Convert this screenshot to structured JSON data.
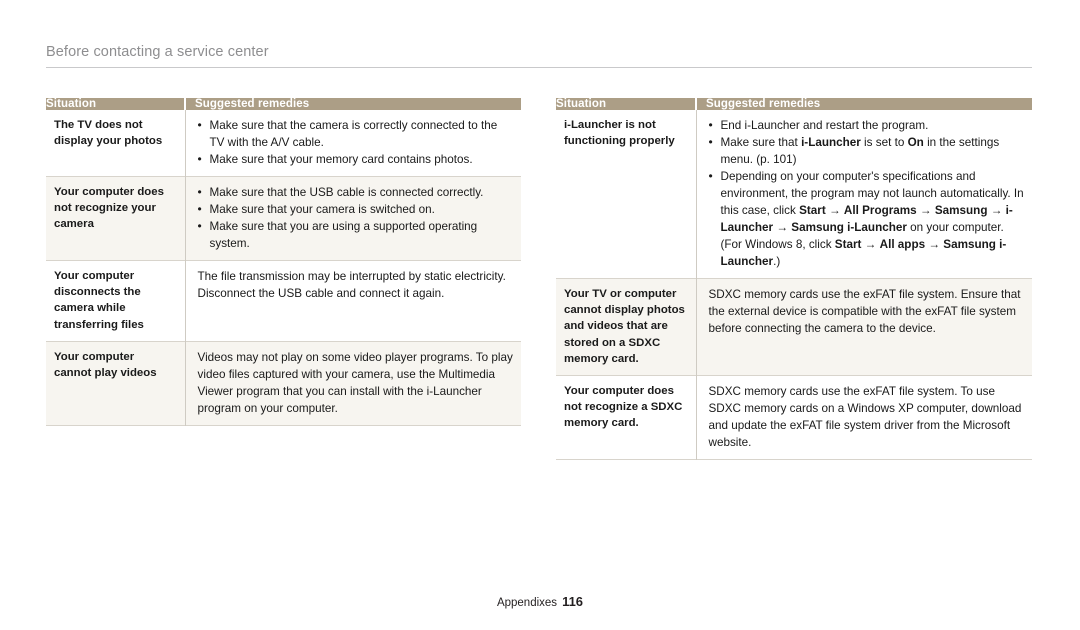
{
  "header": {
    "title": "Before contacting a service center"
  },
  "footer": {
    "section": "Appendixes",
    "page_number": "116"
  },
  "colors": {
    "table_header_bg": "#ac9e86",
    "table_header_text": "#ffffff",
    "alt_row_bg": "#f7f5f0",
    "rule": "#c9c9cb",
    "header_text": "#8e8e90",
    "body_text": "#231f20"
  },
  "tables": {
    "left": {
      "columns": [
        "Situation",
        "Suggested remedies"
      ],
      "rows": [
        {
          "situation": "The TV does not display your photos",
          "bullets": [
            "Make sure that the camera is correctly connected to the TV with the A/V cable.",
            "Make sure that your memory card contains photos."
          ]
        },
        {
          "situation": "Your computer does not recognize your camera",
          "bullets": [
            "Make sure that the USB cable is connected correctly.",
            "Make sure that your camera is switched on.",
            "Make sure that you are using a supported operating system."
          ]
        },
        {
          "situation": "Your computer disconnects the camera while transferring files",
          "paragraph": "The file transmission may be interrupted by static electricity. Disconnect the USB cable and connect it again."
        },
        {
          "situation": "Your computer cannot play videos",
          "paragraph": "Videos may not play on some video player programs. To play video files captured with your camera, use the Multimedia Viewer program that you can install with the i-Launcher program on your computer."
        }
      ]
    },
    "right": {
      "columns": [
        "Situation",
        "Suggested remedies"
      ],
      "rows": [
        {
          "situation": "i-Launcher is not functioning properly",
          "bullets_rich": [
            [
              {
                "t": "End i-Launcher and restart the program."
              }
            ],
            [
              {
                "t": "Make sure that "
              },
              {
                "t": "i-Launcher",
                "b": true
              },
              {
                "t": " is set to "
              },
              {
                "t": "On",
                "b": true
              },
              {
                "t": " in the settings menu. (p. 101)"
              }
            ],
            [
              {
                "t": "Depending on your computer's specifications and environment, the program may not launch automatically. In this case, click "
              },
              {
                "t": "Start",
                "b": true
              },
              {
                "t": " → "
              },
              {
                "t": "All Programs",
                "b": true
              },
              {
                "t": " → "
              },
              {
                "t": "Samsung",
                "b": true
              },
              {
                "t": " → "
              },
              {
                "t": "i-Launcher",
                "b": true
              },
              {
                "t": " → "
              },
              {
                "t": "Samsung i-Launcher",
                "b": true
              },
              {
                "t": " on your computer. (For Windows 8, click "
              },
              {
                "t": "Start",
                "b": true
              },
              {
                "t": " → "
              },
              {
                "t": "All apps",
                "b": true
              },
              {
                "t": " → "
              },
              {
                "t": "Samsung i-Launcher",
                "b": true
              },
              {
                "t": ".)"
              }
            ]
          ]
        },
        {
          "situation": "Your TV or computer cannot display photos and videos that are stored on a SDXC memory card.",
          "paragraph": "SDXC memory cards use the exFAT file system. Ensure that the external device is compatible with the exFAT file system before connecting the camera to the device."
        },
        {
          "situation": "Your computer does not recognize a SDXC memory card.",
          "paragraph": "SDXC memory cards use the exFAT file system. To use SDXC memory cards on a Windows XP computer, download and update the exFAT file system driver from the Microsoft website."
        }
      ]
    }
  }
}
